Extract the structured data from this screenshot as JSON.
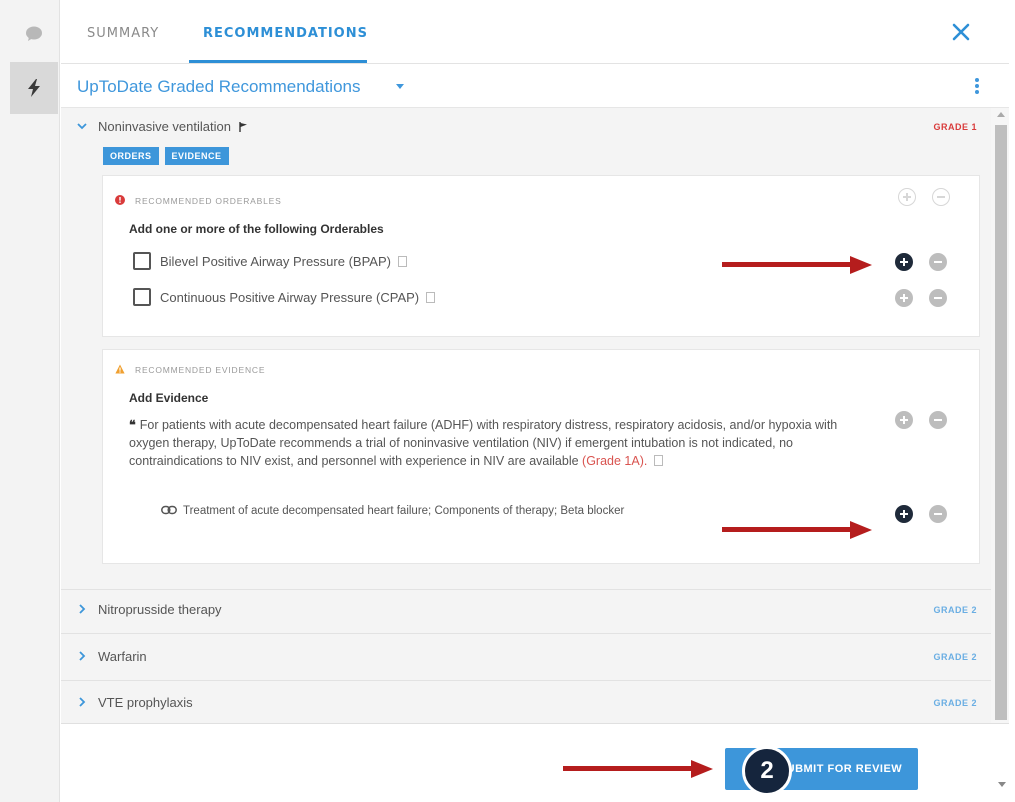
{
  "tabs": {
    "summary": "SUMMARY",
    "recommendations": "RECOMMENDATIONS"
  },
  "selector": {
    "label": "UpToDate Graded Recommendations"
  },
  "recommendations": [
    {
      "title": "Noninvasive ventilation",
      "grade": "GRADE 1",
      "tags": [
        "ORDERS",
        "EVIDENCE"
      ],
      "orderables": {
        "section_label": "RECOMMENDED ORDERABLES",
        "heading": "Add one or more of the following Orderables",
        "items": [
          {
            "label": "Bilevel Positive Airway Pressure (BPAP)"
          },
          {
            "label": "Continuous Positive Airway Pressure (CPAP)"
          }
        ]
      },
      "evidence": {
        "section_label": "RECOMMENDED EVIDENCE",
        "heading": "Add Evidence",
        "quote": "For patients with acute decompensated heart failure (ADHF) with respiratory distress, respiratory acidosis, and/or hypoxia with oxygen therapy, UpToDate recommends a trial of noninvasive ventilation (NIV) if emergent intubation is not indicated, no contraindications to NIV exist, and personnel with experience in NIV are available",
        "quote_grade": "(Grade 1A).",
        "link": "Treatment of acute decompensated heart failure; Components of therapy; Beta blocker"
      }
    },
    {
      "title": "Nitroprusside therapy",
      "grade": "GRADE 2"
    },
    {
      "title": "Warfarin",
      "grade": "GRADE 2"
    },
    {
      "title": "VTE prophylaxis",
      "grade": "GRADE 2"
    }
  ],
  "footer": {
    "step_number": "2",
    "submit_label": "SUBMIT FOR REVIEW"
  },
  "colors": {
    "accent": "#3d96da",
    "grade_red": "#d93b3b",
    "annotation_arrow": "#b51d1d",
    "badge": "#15253d"
  }
}
